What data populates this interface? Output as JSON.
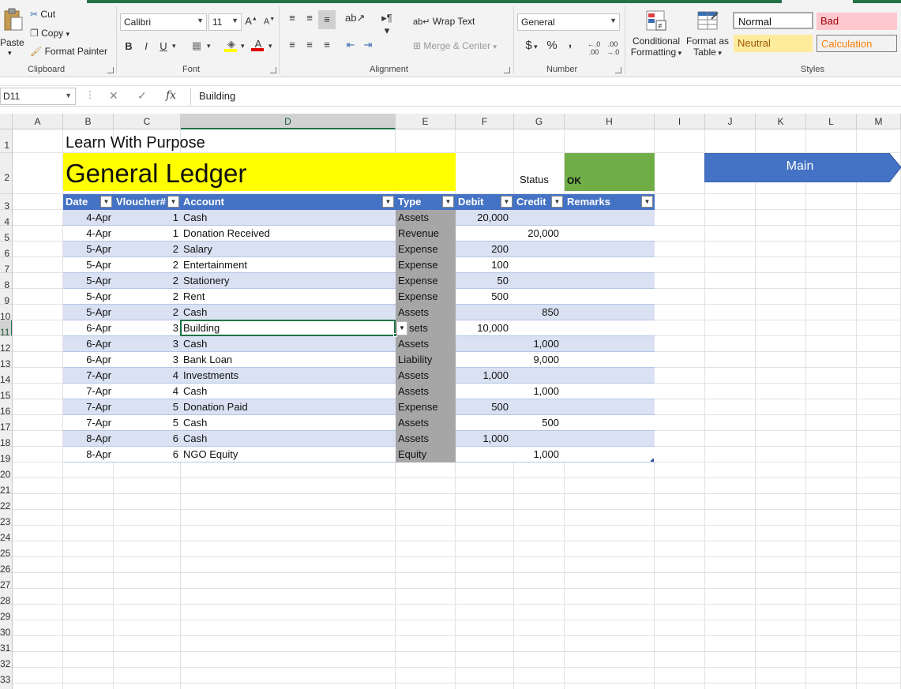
{
  "ribbon": {
    "clipboard": {
      "paste": "Paste",
      "cut": "Cut",
      "copy": "Copy",
      "format_painter": "Format Painter",
      "label": "Clipboard"
    },
    "font": {
      "name": "Calibri",
      "size": "11",
      "bold": "B",
      "italic": "I",
      "underline": "U",
      "label": "Font"
    },
    "alignment": {
      "wrap_text": "Wrap Text",
      "merge_center": "Merge & Center",
      "label": "Alignment"
    },
    "number": {
      "format": "General",
      "currency": "$",
      "percent": "%",
      "comma": ",",
      "label": "Number"
    },
    "styles": {
      "conditional": "Conditional",
      "conditional2": "Formatting",
      "format_as": "Format as",
      "format_as2": "Table",
      "normal": "Normal",
      "bad": "Bad",
      "neutral": "Neutral",
      "calculation": "Calculation",
      "label": "Styles"
    }
  },
  "formula_bar": {
    "name_box": "D11",
    "formula": "Building"
  },
  "columns": [
    "A",
    "B",
    "C",
    "D",
    "E",
    "F",
    "G",
    "H",
    "I",
    "J",
    "K",
    "L",
    "M"
  ],
  "row_numbers": [
    "1",
    "2",
    "3",
    "4",
    "5",
    "6",
    "7",
    "8",
    "9",
    "10",
    "11",
    "12",
    "13",
    "14",
    "15",
    "16",
    "17",
    "18",
    "19",
    "20",
    "21",
    "22",
    "23",
    "24",
    "25",
    "26",
    "27",
    "28",
    "29",
    "30",
    "31",
    "32",
    "33"
  ],
  "sheet": {
    "subtitle": "Learn With Purpose",
    "title": "General Ledger",
    "status_label": "Status",
    "status_value": "OK",
    "main_button": "Main",
    "headers": [
      "Date",
      "Vloucher#",
      "Account",
      "Type",
      "Debit",
      "Credit",
      "Remarks"
    ],
    "rows": [
      {
        "date": "4-Apr",
        "voucher": "1",
        "account": "Cash",
        "type": "Assets",
        "debit": "20,000",
        "credit": ""
      },
      {
        "date": "4-Apr",
        "voucher": "1",
        "account": "Donation Received",
        "type": "Revenue",
        "debit": "",
        "credit": "20,000"
      },
      {
        "date": "5-Apr",
        "voucher": "2",
        "account": "Salary",
        "type": "Expense",
        "debit": "200",
        "credit": ""
      },
      {
        "date": "5-Apr",
        "voucher": "2",
        "account": "Entertainment",
        "type": "Expense",
        "debit": "100",
        "credit": ""
      },
      {
        "date": "5-Apr",
        "voucher": "2",
        "account": "Stationery",
        "type": "Expense",
        "debit": "50",
        "credit": ""
      },
      {
        "date": "5-Apr",
        "voucher": "2",
        "account": "Rent",
        "type": "Expense",
        "debit": "500",
        "credit": ""
      },
      {
        "date": "5-Apr",
        "voucher": "2",
        "account": "Cash",
        "type": "Assets",
        "debit": "",
        "credit": "850"
      },
      {
        "date": "6-Apr",
        "voucher": "3",
        "account": "Building",
        "type": "sets",
        "debit": "10,000",
        "credit": ""
      },
      {
        "date": "6-Apr",
        "voucher": "3",
        "account": "Cash",
        "type": "Assets",
        "debit": "",
        "credit": "1,000"
      },
      {
        "date": "6-Apr",
        "voucher": "3",
        "account": "Bank Loan",
        "type": "Liability",
        "debit": "",
        "credit": "9,000"
      },
      {
        "date": "7-Apr",
        "voucher": "4",
        "account": "Investments",
        "type": "Assets",
        "debit": "1,000",
        "credit": ""
      },
      {
        "date": "7-Apr",
        "voucher": "4",
        "account": "Cash",
        "type": "Assets",
        "debit": "",
        "credit": "1,000"
      },
      {
        "date": "7-Apr",
        "voucher": "5",
        "account": "Donation Paid",
        "type": "Expense",
        "debit": "500",
        "credit": ""
      },
      {
        "date": "7-Apr",
        "voucher": "5",
        "account": "Cash",
        "type": "Assets",
        "debit": "",
        "credit": "500"
      },
      {
        "date": "8-Apr",
        "voucher": "6",
        "account": "Cash",
        "type": "Assets",
        "debit": "1,000",
        "credit": ""
      },
      {
        "date": "8-Apr",
        "voucher": "6",
        "account": "NGO Equity",
        "type": "Equity",
        "debit": "",
        "credit": "1,000"
      }
    ]
  },
  "colors": {
    "title_fill": "#ffff00",
    "status_fill": "#70ad47",
    "table_header": "#4472c4",
    "band": "#d9e1f2",
    "type_col": "#a6a6a6",
    "main_button": "#4472c4"
  }
}
